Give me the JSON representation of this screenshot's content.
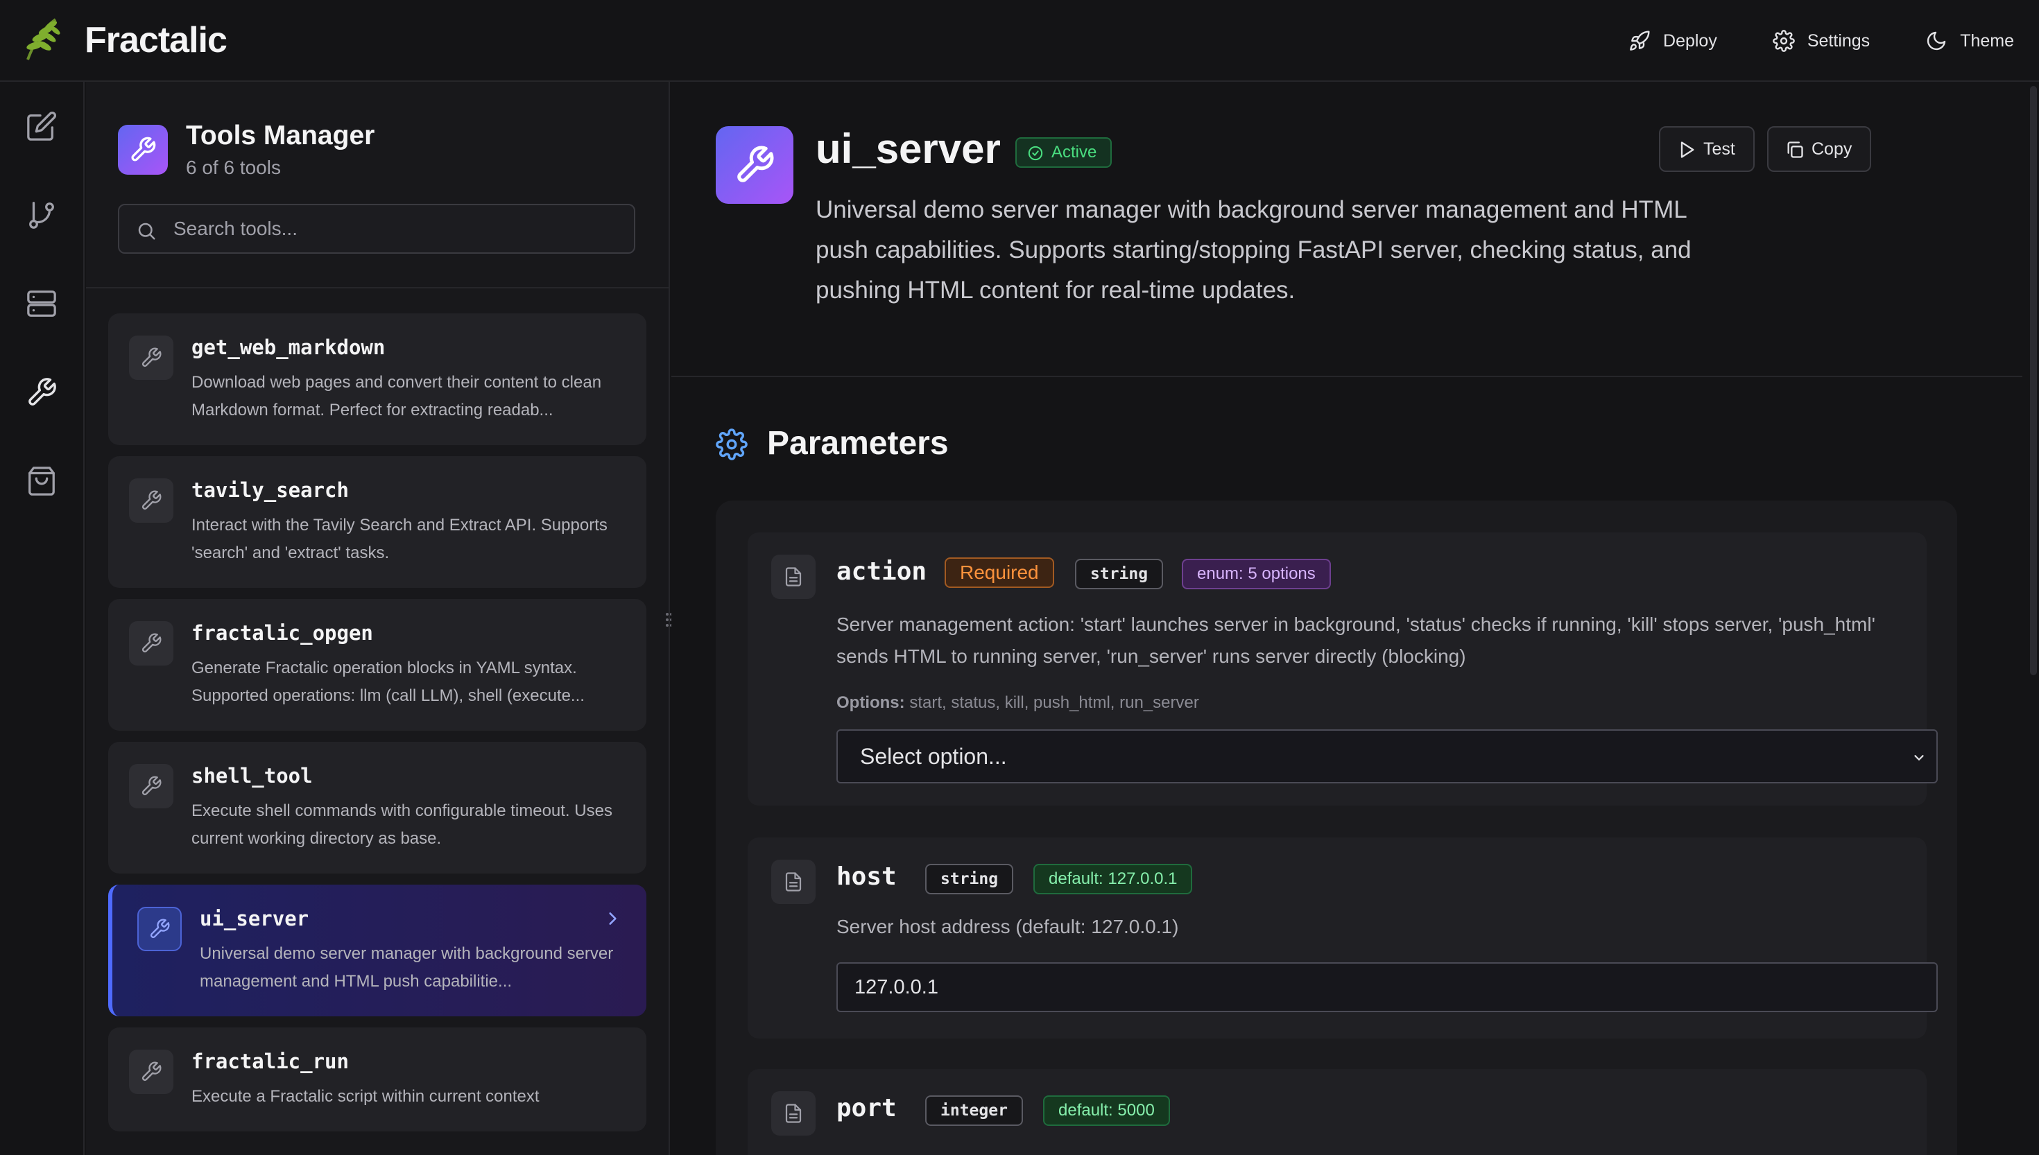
{
  "app": {
    "brand": "Fractalic",
    "nav": [
      {
        "label": "Deploy",
        "icon": "rocket-icon"
      },
      {
        "label": "Settings",
        "icon": "gear-icon"
      },
      {
        "label": "Theme",
        "icon": "moon-icon"
      }
    ]
  },
  "rail": [
    {
      "name": "edit-icon"
    },
    {
      "name": "git-branch-icon"
    },
    {
      "name": "server-icon"
    },
    {
      "name": "wrench-icon"
    },
    {
      "name": "shopping-bag-icon"
    }
  ],
  "tools_panel": {
    "title": "Tools Manager",
    "count": "6 of 6 tools",
    "search_placeholder": "Search tools...",
    "tools": [
      {
        "name": "get_web_markdown",
        "desc": "Download web pages and convert their content to clean Markdown format. Perfect for extracting readab..."
      },
      {
        "name": "tavily_search",
        "desc": "Interact with the Tavily Search and Extract API. Supports 'search' and 'extract' tasks."
      },
      {
        "name": "fractalic_opgen",
        "desc": "Generate Fractalic operation blocks in YAML syntax. Supported operations: llm (call LLM), shell (execute..."
      },
      {
        "name": "shell_tool",
        "desc": "Execute shell commands with configurable timeout. Uses current working directory as base."
      },
      {
        "name": "ui_server",
        "desc": "Universal demo server manager with background server management and HTML push capabilitie..."
      },
      {
        "name": "fractalic_run",
        "desc": "Execute a Fractalic script within current context"
      }
    ],
    "selected_index": 4
  },
  "detail": {
    "title": "ui_server",
    "status": "Active",
    "description": "Universal demo server manager with background server management and HTML push capabilities. Supports starting/stopping FastAPI server, checking status, and pushing HTML content for real-time updates.",
    "test_label": "Test",
    "copy_label": "Copy",
    "parameters_title": "Parameters",
    "params": [
      {
        "name": "action",
        "required": "Required",
        "type": "string",
        "enum": "enum: 5 options",
        "desc": "Server management action: 'start' launches server in background, 'status' checks if running, 'kill' stops server, 'push_html' sends HTML to running server, 'run_server' runs server directly (blocking)",
        "options_label": "Options:",
        "options": "start, status, kill, push_html, run_server",
        "select_value": "Select option..."
      },
      {
        "name": "host",
        "type": "string",
        "default": "default: 127.0.0.1",
        "desc": "Server host address (default: 127.0.0.1)",
        "value": "127.0.0.1"
      },
      {
        "name": "port",
        "type": "integer",
        "default": "default: 5000"
      }
    ]
  }
}
